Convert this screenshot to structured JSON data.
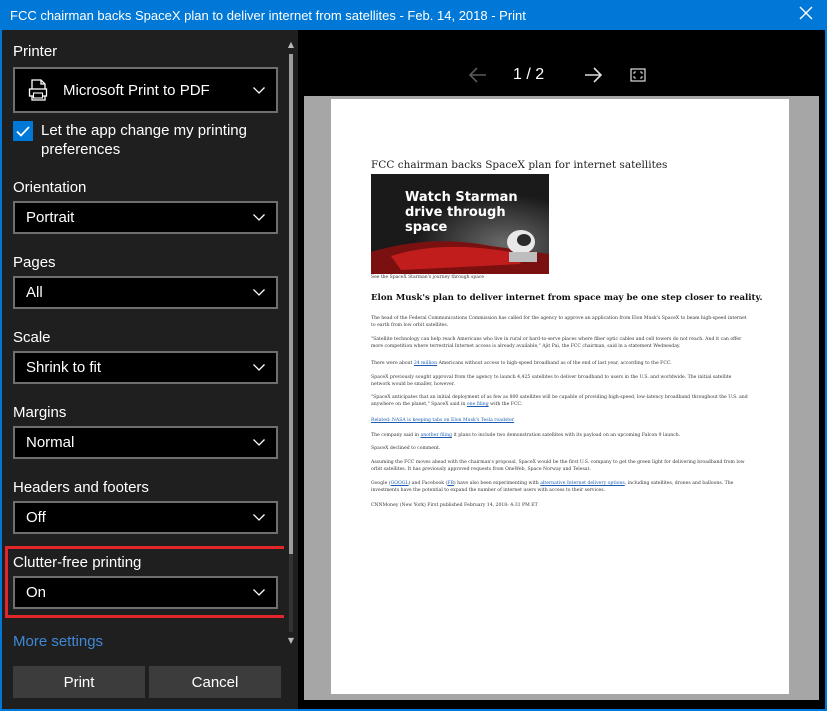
{
  "window": {
    "title": "FCC chairman backs SpaceX plan to deliver internet from satellites - Feb. 14, 2018 - Print"
  },
  "icons": {
    "close": "close-icon",
    "printer": "printer-icon",
    "chevron": "chevron-down-icon",
    "check": "checkmark-icon",
    "prev": "arrow-left-icon",
    "next": "arrow-right-icon",
    "fullscreen": "fullscreen-icon"
  },
  "colors": {
    "accent": "#0078d7",
    "highlight": "#e3262a",
    "panel": "#1f1f1f",
    "link": "#3f88d8"
  },
  "settings": {
    "printer_label": "Printer",
    "printer_value": "Microsoft Print to PDF",
    "app_pref_label": "Let the app change my printing preferences",
    "app_pref_checked": true,
    "orientation_label": "Orientation",
    "orientation_value": "Portrait",
    "pages_label": "Pages",
    "pages_value": "All",
    "scale_label": "Scale",
    "scale_value": "Shrink to fit",
    "margins_label": "Margins",
    "margins_value": "Normal",
    "headers_label": "Headers and footers",
    "headers_value": "Off",
    "clutter_label": "Clutter-free printing",
    "clutter_value": "On",
    "more_settings": "More settings"
  },
  "buttons": {
    "print": "Print",
    "cancel": "Cancel"
  },
  "preview": {
    "page_indicator": "1 / 2",
    "doc": {
      "title": "FCC chairman backs SpaceX plan for internet satellites",
      "image_text": "Watch Starman drive through space",
      "image_caption": "See the SpaceX Starman's journey through space",
      "headline": "Elon Musk's plan to deliver internet from space may be one step closer to reality.",
      "p1": "The head of the Federal Communications Commission has called for the agency to approve an application from Elon Musk's SpaceX to beam high-speed internet to earth from low orbit satellites.",
      "p2": "\"Satellite technology can help reach Americans who live in rural or hard-to-serve places where fiber optic cables and cell towers do not reach. And it can offer more competition where terrestrial Internet access is already available,\" Ajit Pai, the FCC chairman, said in a statement Wednesday.",
      "p3a": "There were about ",
      "p3_link": "24 million",
      "p3b": " Americans without access to high-speed broadband as of the end of last year, according to the FCC.",
      "p4": "SpaceX previously sought approval from the agency to launch 4,425 satellites to deliver broadband to users in the U.S. and worldwide. The initial satellite network would be smaller, however.",
      "p5a": "\"SpaceX anticipates that an initial deployment of as few as 800 satellites will be capable of providing high-speed, low-latency broadband throughout the U.S. and anywhere on the planet,\" SpaceX said in ",
      "p5_link": "one filing",
      "p5b": " with the FCC.",
      "related": "Related: NASA is keeping tabs on Elon Musk's Tesla roadster",
      "p6a": "The company said in ",
      "p6_link": "another filing",
      "p6b": " it plans to include two demonstration satellites with its payload on an upcoming Falcon 9 launch.",
      "p7": "SpaceX declined to comment.",
      "p8": "Assuming the FCC moves ahead with the chairman's proposal, SpaceX would be the first U.S. company to get the green light for delivering broadband from low orbit satellites. It has previously approved requests from OneWeb, Space Norway and Telesat.",
      "p9a": "Google (",
      "p9_link1": "GOOGL",
      "p9b": ") and Facebook (",
      "p9_link2": "FB",
      "p9c": ") have also been experimenting with ",
      "p9_link3": "alternative Internet delivery options",
      "p9d": ", including satellites, drones and balloons. The investments have the potential to expand the number of internet users with access to their services.",
      "p10": "CNNMoney (New York) First published February 14, 2018: 4:31 PM ET"
    }
  }
}
